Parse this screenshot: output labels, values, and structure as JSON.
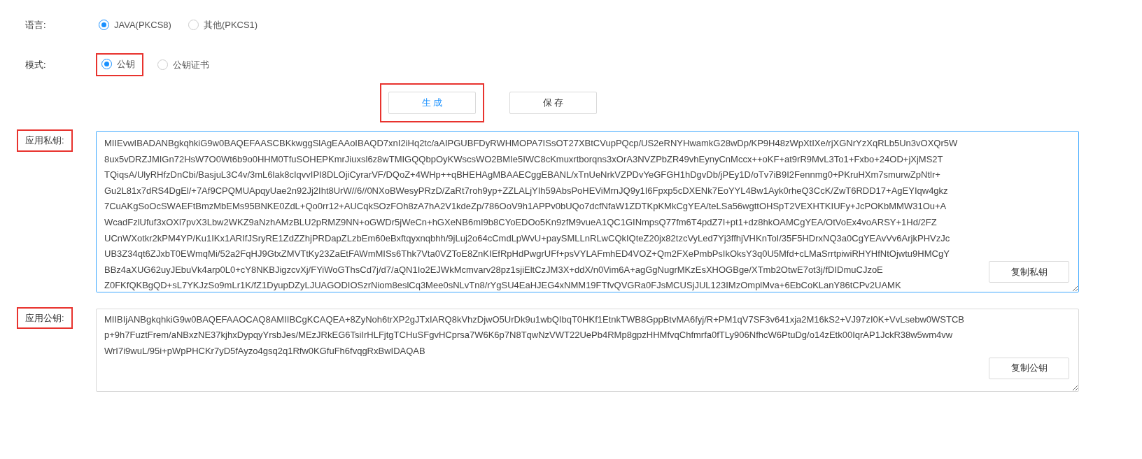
{
  "language": {
    "label": "语言:",
    "options": [
      {
        "label": "JAVA(PKCS8)",
        "selected": true,
        "highlighted": false
      },
      {
        "label": "其他(PKCS1)",
        "selected": false,
        "highlighted": false
      }
    ]
  },
  "mode": {
    "label": "模式:",
    "options": [
      {
        "label": "公钥",
        "selected": true,
        "highlighted": true
      },
      {
        "label": "公钥证书",
        "selected": false,
        "highlighted": false
      }
    ]
  },
  "actions": [
    {
      "label": "生 成",
      "kind": "primary",
      "highlighted": true
    },
    {
      "label": "保 存",
      "kind": "default",
      "highlighted": false
    }
  ],
  "private_key": {
    "label": "应用私钥:",
    "highlighted": true,
    "copy_button": "复制私钥",
    "lines": [
      "MIIEvwIBADANBgkqhkiG9w0BAQEFAASCBKkwggSlAgEAAoIBAQD7xnI2iHq2tc/aAIPGUBFDyRWHMOPA7ISsOT27XBtCVupPQcp/US2eRNYHwamkG28wDp/KP9H48zWpXtIXe/rjXGNrYzXqRLb5Un3vOXQr5W",
      "8ux5vDRZJMIGn72HsW7O0Wt6b9o0HHM0TfuSOHEPKmrJiuxsl6z8wTMIGQQbpOyKWscsWO2BMIe5IWC8cKmuxrtborqns3xOrA3NVZPbZR49vhEynyCnMccx++oKF+at9rR9MvL3To1+Fxbo+24OD+jXjMS2T",
      "TQiqsA/UlyRHfzDnCbi/BasjuL3C4v/3mL6lak8cIqvvIPI8DLOjiCyrarVF/DQoZ+4WHp++qBHEHAgMBAAECggEBANL/xTnUeNrkVZPDvYeGFGH1hDgvDb/jPEy1D/oTv7iB9I2Fennmg0+PKruHXm7smurwZpNtlr+",
      "Gu2L81x7dRS4DgEl/+7Af9CPQMUApqyUae2n92Jj2Iht8UrW//6//0NXoBWesyPRzD/ZaRt7roh9yp+ZZLALjYIh59AbsPoHEViMrnJQ9y1I6Fpxp5cDXENk7EoYYL4Bw1Ayk0rheQ3CcK/ZwT6RDD17+AgEYIqw4gkz",
      "7CuAKgSoOcSWAEFtBmzMbEMs95BNKE0ZdL+Qo0rr12+AUCqkSOzFOh8zA7hA2V1kdeZp/786OoV9h1APPv0bUQo7dcfNfaW1ZDTKpKMkCgYEA/teLSa56wgttOHSpT2VEXHTKIUFy+JcPOKbMMW31Ou+A",
      "WcadFzlUfuf3xOXl7pvX3Lbw2WKZ9aNzhAMzBLU2pRMZ9NN+oGWDr5jWeCn+hGXeNB6mI9b8CYoEDOo5Kn9zfM9vueA1QC1GINmpsQ77fm6T4pdZ7I+pt1+dz8hkOAMCgYEA/OtVoEx4voARSY+1Hd/2FZ",
      "UCnWXotkr2kPM4YP/Ku1IKx1ARIfJSryRE1ZdZZhjPRDapZLzbEm60eBxftqyxnqbhh/9jLuj2o64cCmdLpWvU+paySMLLnRLwCQkIQteZ20jx82tzcVyLed7Yj3ffhjVHKnToI/35F5HDrxNQ3a0CgYEAvVv6ArjkPHVzJc",
      "UB3Z34qt6ZJxbT0EWmqMi/52a2FqHJ9GtxZMVTtKy23ZaEtFAWmMISs6Thk7Vta0VZToE8ZnKIEfRpHdPwgrUFf+psVYLAFmhED4VOZ+Qm2FXePmbPsIkOksY3q0U5Mfd+cLMaSrrtpiwiRHYHfNtOjwtu9HMCgY",
      "BBz4aXUG62uyJEbuVk4arp0L0+cY8NKBJigzcvXj/FYiWoGThsCd7j/d7/aQN1Io2EJWkMcmvarv28pz1sjiEltCzJM3X+ddX/n0Vim6A+agGgNugrMKzEsXHOGBge/XTmb2OtwE7ot3j/fDIDmuCJzoE",
      "Z0FKfQKBgQD+sL7YKJzSo9mLr1K/fZ1DyupDZyLJUAGODIOSzrNiom8eslCq3Mee0sNLvTn8/rYgSU4EaHJEG4xNMM19FTfvQVGRa0FJsMCUSjJUL123IMzOmplMva+6EbCoKLanY86tCPv2UAMK"
    ]
  },
  "public_key": {
    "label": "应用公钥:",
    "highlighted": true,
    "copy_button": "复制公钥",
    "lines": [
      "MIIBIjANBgkqhkiG9w0BAQEFAAOCAQ8AMIIBCgKCAQEA+8ZyNoh6trXP2gJTxIARQ8kVhzDjwO5UrDk9u1wbQIbqT0HKf1EtnkTWB8GppBtvMA6fyj/R+PM1qV7SF3v641xja2M16kS2+VJ97zI0K+VvLsebw0WSTCB",
      "p+9h7FuztFrem/aNBxzNE37kjhxDypqyYrsbJes/MEzJRkEG6TsiIrHLFjtgTCHuSFgvHCprsa7W6K6p7N8TqwNzVWT22UePb4RMp8gpzHHMfvqChfmrfa0fTLy906NfhcW6PtuDg/o14zEtk00IqrAP1JckR38w5wm4vw",
      "WrI7i9wuL/95i+pWpPHCKr7yD5fAyzo4gsq2q1Rfw0KGfuFh6fvqgRxBwIDAQAB"
    ]
  }
}
